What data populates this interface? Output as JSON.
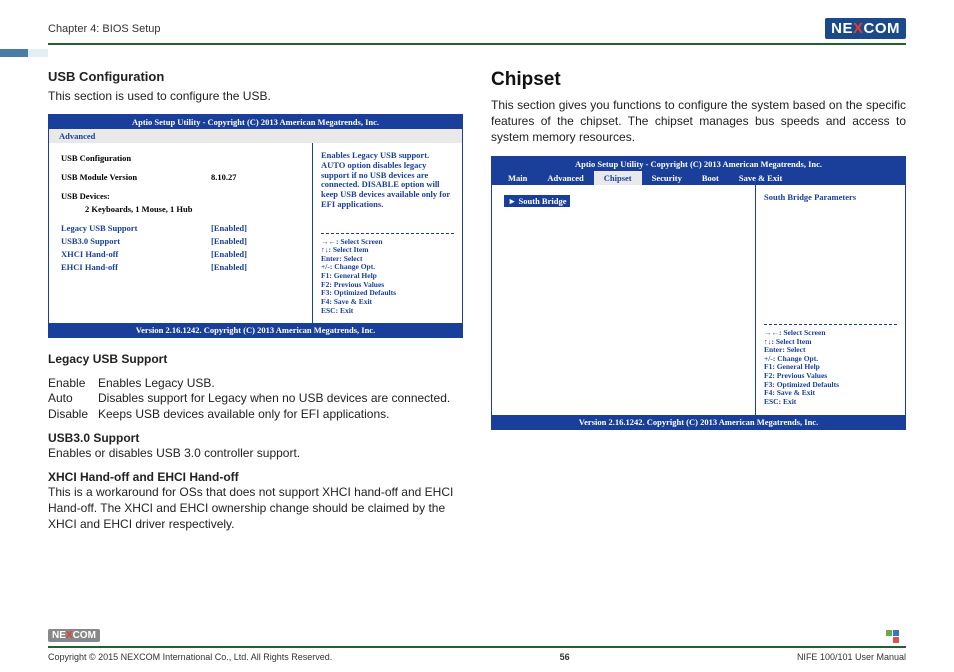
{
  "header": {
    "chapter": "Chapter 4: BIOS Setup",
    "brand": "NEXCOM"
  },
  "left": {
    "usb_title": "USB Configuration",
    "usb_desc": "This section is used to configure the USB.",
    "bios": {
      "titlebar": "Aptio Setup Utility - Copyright (C) 2013 American Megatrends, Inc.",
      "submenu": "Advanced",
      "rows": {
        "header": "USB Configuration",
        "mod_label": "USB Module Version",
        "mod_value": "8.10.27",
        "dev_label": "USB Devices:",
        "dev_value": "2 Keyboards, 1 Mouse, 1 Hub",
        "legacy_label": "Legacy USB Support",
        "legacy_value": "[Enabled]",
        "usb3_label": "USB3.0 Support",
        "usb3_value": "[Enabled]",
        "xhci_label": "XHCI Hand-off",
        "xhci_value": "[Enabled]",
        "ehci_label": "EHCI Hand-off",
        "ehci_value": "[Enabled]"
      },
      "help": "Enables Legacy USB support. AUTO option disables legacy support if no USB devices are connected. DISABLE option will keep USB devices available only for EFI applications.",
      "keys": {
        "k1": "→←: Select Screen",
        "k2": "↑↓: Select Item",
        "k3": "Enter: Select",
        "k4": "+/-: Change Opt.",
        "k5": "F1: General Help",
        "k6": "F2: Previous Values",
        "k7": "F3: Optimized Defaults",
        "k8": "F4: Save & Exit",
        "k9": "ESC: Exit"
      },
      "footer": "Version 2.16.1242. Copyright (C) 2013 American Megatrends, Inc."
    },
    "legacy_title": "Legacy USB Support",
    "legacy_enable_k": "Enable",
    "legacy_enable_v": "Enables Legacy USB.",
    "legacy_auto_k": "Auto",
    "legacy_auto_v": "Disables support for Legacy when no USB devices are connected.",
    "legacy_disable_k": "Disable",
    "legacy_disable_v": "Keeps USB devices available only for EFI applications.",
    "usb3_title": "USB3.0 Support",
    "usb3_desc": "Enables or disables USB 3.0 controller support.",
    "handoff_title": "XHCI Hand-off and EHCI Hand-off",
    "handoff_desc": "This is a workaround for OSs that does not support XHCI hand-off and EHCI Hand-off. The XHCI and EHCI ownership change should be claimed by the XHCI and EHCI driver respectively."
  },
  "right": {
    "chipset_title": "Chipset",
    "chipset_desc": "This section gives you functions to configure the system based on the specific features of the chipset. The chipset manages bus speeds and access to system memory resources.",
    "bios": {
      "titlebar": "Aptio Setup Utility - Copyright (C) 2013 American Megatrends, Inc.",
      "menu": {
        "main": "Main",
        "advanced": "Advanced",
        "chipset": "Chipset",
        "security": "Security",
        "boot": "Boot",
        "save": "Save & Exit"
      },
      "item": "► South Bridge",
      "help": "South Bridge Parameters",
      "footer": "Version 2.16.1242. Copyright (C) 2013 American Megatrends, Inc."
    }
  },
  "footer": {
    "copyright": "Copyright © 2015 NEXCOM International Co., Ltd. All Rights Reserved.",
    "page": "56",
    "manual": "NIFE 100/101 User Manual"
  }
}
